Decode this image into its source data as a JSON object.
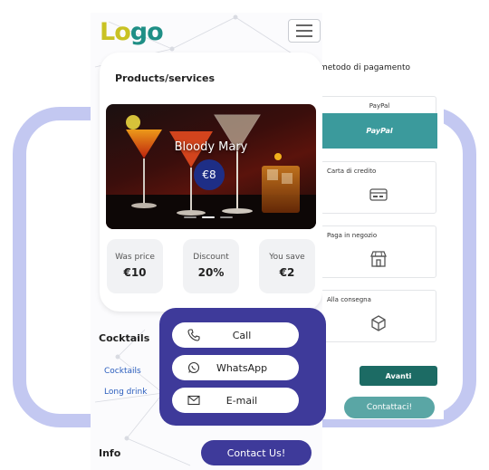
{
  "header": {
    "logo_part1": "Lo",
    "logo_part2": "go",
    "menu_icon": "hamburger-menu-icon"
  },
  "products": {
    "title": "Products/services",
    "item_name": "Bloody Mary",
    "item_price": "€8",
    "slides": 3,
    "active_slide": 2,
    "stats": [
      {
        "label": "Was price",
        "value": "€10"
      },
      {
        "label": "Discount",
        "value": "20%"
      },
      {
        "label": "You save",
        "value": "€2"
      }
    ]
  },
  "cocktails": {
    "title": "Cocktails",
    "links": [
      "Cocktails",
      "Long drink"
    ]
  },
  "contact_popup": {
    "call": "Call",
    "whatsapp": "WhatsApp",
    "email": "E-mail"
  },
  "info": {
    "title": "Info",
    "contact_button": "Contact Us!"
  },
  "payment": {
    "title": "metodo di pagamento",
    "options": [
      {
        "label": "PayPal",
        "button": "PayPal",
        "icon": "paypal-icon"
      },
      {
        "label": "Carta di credito",
        "icon": "credit-card-icon"
      },
      {
        "label": "Paga in negozio",
        "icon": "store-icon"
      },
      {
        "label": "Alla consegna",
        "icon": "package-icon"
      }
    ],
    "next_button": "Avanti",
    "contact_button": "Contattaci!"
  },
  "colors": {
    "primary": "#3e3a9a",
    "teal": "#3b9a9c",
    "dark_teal": "#1c6b64",
    "lilac_frame": "#c3c8f1",
    "logo_yellow": "#c9c223",
    "logo_teal": "#1f8f86"
  }
}
